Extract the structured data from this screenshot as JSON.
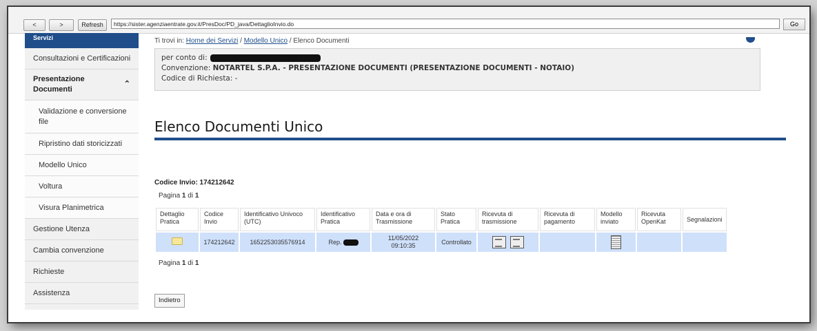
{
  "toolbar": {
    "back_label": "<",
    "forward_label": ">",
    "refresh_label": "Refresh",
    "url": "https://sister.agenziaentrate.gov.it/PresDoc/PD_java/DettaglioInvio.do",
    "go_label": "Go"
  },
  "sidebar": {
    "top_label": "Servizi",
    "items": [
      {
        "label": "Consultazioni e Certificazioni"
      },
      {
        "label": "Presentazione Documenti"
      },
      {
        "label": "Validazione e conversione file"
      },
      {
        "label": "Ripristino dati storicizzati"
      },
      {
        "label": "Modello Unico"
      },
      {
        "label": "Voltura"
      },
      {
        "label": "Visura Planimetrica"
      },
      {
        "label": "Gestione Utenza"
      },
      {
        "label": "Cambia convenzione"
      },
      {
        "label": "Richieste"
      },
      {
        "label": "Assistenza"
      }
    ]
  },
  "breadcrumb": {
    "prefix": "Ti trovi in:",
    "home": "Home dei Servizi",
    "sep1": "/",
    "modello": "Modello Unico",
    "sep2": "/",
    "current": "Elenco Documenti"
  },
  "info": {
    "conto_label": "per conto di:",
    "convenzione_label": "Convenzione:",
    "convenzione_value": "NOTARTEL S.P.A. - PRESENTAZIONE DOCUMENTI (PRESENTAZIONE DOCUMENTI - NOTAIO)",
    "codice_richiesta": "Codice di Richiesta: -"
  },
  "page_title": "Elenco Documenti Unico",
  "codice_invio": "Codice Invio: 174212642",
  "pagination": {
    "prefix": "Pagina",
    "current": "1",
    "of": "di",
    "total": "1"
  },
  "table": {
    "headers": [
      "Dettaglio Pratica",
      "Codice Invio",
      "Identificativo Univoco (UTC)",
      "Identificativo Pratica",
      "Data e ora di Trasmissione",
      "Stato Pratica",
      "Ricevuta di trasmissione",
      "Ricevuta di pagamento",
      "Modello inviato",
      "Ricevuta OpenKat",
      "Segnalazioni"
    ],
    "row": {
      "codice_invio": "174212642",
      "utc": "1652253035576914",
      "pratica": "Rep.",
      "data": "11/05/2022",
      "ora": "09:10:35",
      "stato": "Controllato"
    }
  },
  "back_label": "Indietro",
  "colors": {
    "accent": "#1f4e8a",
    "row_bg": "#cfe0fb",
    "sidebar_bg": "#f1f1f1"
  },
  "icons": [
    "folder-icon",
    "receipt-icon",
    "receipt-alt-icon",
    "document-icon",
    "user-icon"
  ]
}
